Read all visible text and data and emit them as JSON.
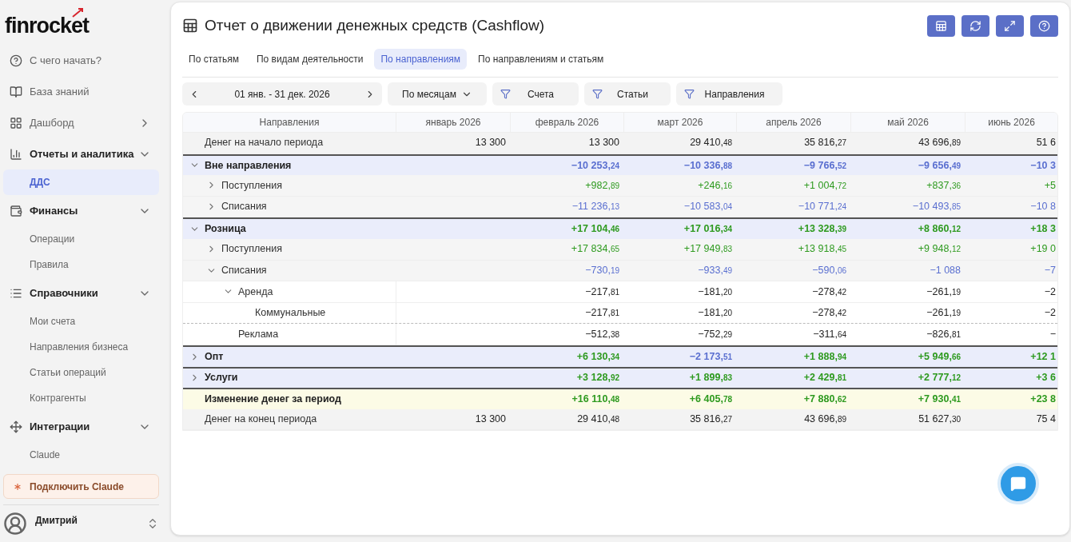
{
  "sidebar": {
    "logo": "finrocket",
    "nav": [
      {
        "kind": "link",
        "label": "С чего начать?"
      },
      {
        "kind": "link",
        "label": "База знаний"
      },
      {
        "kind": "section",
        "label": "Дашборд",
        "expanded": false
      },
      {
        "kind": "section",
        "label": "Отчеты и аналитика",
        "expanded": true,
        "children": [
          {
            "label": "ДДС",
            "selected": true
          }
        ]
      },
      {
        "kind": "section",
        "label": "Финансы",
        "expanded": true,
        "children": [
          {
            "label": "Операции",
            "selected": false
          },
          {
            "label": "Правила",
            "selected": false
          }
        ]
      },
      {
        "kind": "section",
        "label": "Справочники",
        "expanded": true,
        "children": [
          {
            "label": "Мои счета",
            "selected": false
          },
          {
            "label": "Направления бизнеса",
            "selected": false
          },
          {
            "label": "Статьи операций",
            "selected": false
          },
          {
            "label": "Контрагенты",
            "selected": false
          }
        ]
      },
      {
        "kind": "section",
        "label": "Интеграции",
        "expanded": true,
        "children": [
          {
            "label": "Claude",
            "selected": false
          }
        ]
      }
    ],
    "connect_button": "Подключить Claude",
    "user": {
      "name": "Дмитрий"
    }
  },
  "header": {
    "title": "Отчет о движении денежных средств (Cashflow)"
  },
  "tabs": [
    {
      "label": "По статьям",
      "selected": false
    },
    {
      "label": "По видам деятельности",
      "selected": false
    },
    {
      "label": "По направлениям",
      "selected": true
    },
    {
      "label": "По направлениям и статьям",
      "selected": false
    }
  ],
  "toolbar": {
    "date_range": "01 янв. - 31 дек. 2026",
    "period": "По месяцам",
    "filters": [
      "Счета",
      "Статьи",
      "Направления"
    ]
  },
  "table": {
    "columns": [
      "Направления",
      "январь 2026",
      "февраль 2026",
      "март 2026",
      "апрель 2026",
      "май 2026",
      "июнь 2026"
    ],
    "rows": [
      {
        "kind": "balance",
        "label": "Денег на начало периода",
        "start": {
          "text": "13 300",
          "kind": "plain"
        },
        "values": [
          {
            "text": "13 300",
            "kind": "plain"
          },
          {
            "text": "29 410,48",
            "kind": "plain"
          },
          {
            "text": "35 816,27",
            "kind": "plain"
          },
          {
            "text": "43 696,89",
            "kind": "plain"
          },
          {
            "text": "51 6",
            "kind": "plain"
          }
        ]
      },
      {
        "kind": "group",
        "label": "Вне направления",
        "expanded": true,
        "values": [
          {
            "text": "−10 253,24",
            "kind": "expense"
          },
          {
            "text": "−10 336,88",
            "kind": "expense"
          },
          {
            "text": "−9 766,52",
            "kind": "expense"
          },
          {
            "text": "−9 656,49",
            "kind": "expense"
          },
          {
            "text": "−10 3",
            "kind": "expense"
          }
        ],
        "children": [
          {
            "kind": "sub",
            "label": "Поступления",
            "expanded": false,
            "values": [
              {
                "text": "+982,89",
                "kind": "income"
              },
              {
                "text": "+246,16",
                "kind": "income"
              },
              {
                "text": "+1 004,72",
                "kind": "income"
              },
              {
                "text": "+837,36",
                "kind": "income"
              },
              {
                "text": "+5",
                "kind": "income"
              }
            ]
          },
          {
            "kind": "sub",
            "label": "Списания",
            "expanded": false,
            "values": [
              {
                "text": "−11 236,13",
                "kind": "expense"
              },
              {
                "text": "−10 583,04",
                "kind": "expense"
              },
              {
                "text": "−10 771,24",
                "kind": "expense"
              },
              {
                "text": "−10 493,85",
                "kind": "expense"
              },
              {
                "text": "−10 8",
                "kind": "expense"
              }
            ]
          }
        ]
      },
      {
        "kind": "group",
        "label": "Розница",
        "expanded": true,
        "values": [
          {
            "text": "+17 104,46",
            "kind": "income"
          },
          {
            "text": "+17 016,34",
            "kind": "income"
          },
          {
            "text": "+13 328,39",
            "kind": "income"
          },
          {
            "text": "+8 860,12",
            "kind": "income"
          },
          {
            "text": "+18 3",
            "kind": "income"
          }
        ],
        "children": [
          {
            "kind": "sub",
            "label": "Поступления",
            "expanded": false,
            "values": [
              {
                "text": "+17 834,65",
                "kind": "income"
              },
              {
                "text": "+17 949,83",
                "kind": "income"
              },
              {
                "text": "+13 918,45",
                "kind": "income"
              },
              {
                "text": "+9 948,12",
                "kind": "income"
              },
              {
                "text": "+19 0",
                "kind": "income"
              }
            ]
          },
          {
            "kind": "sub",
            "label": "Списания",
            "expanded": true,
            "values": [
              {
                "text": "−730,19",
                "kind": "expense"
              },
              {
                "text": "−933,49",
                "kind": "expense"
              },
              {
                "text": "−590,06",
                "kind": "expense"
              },
              {
                "text": "−1 088",
                "kind": "expense"
              },
              {
                "text": "−7",
                "kind": "expense"
              }
            ],
            "children": [
              {
                "kind": "item",
                "label": "Аренда",
                "expanded": true,
                "values": [
                  {
                    "text": "−217,81",
                    "kind": "plain"
                  },
                  {
                    "text": "−181,20",
                    "kind": "plain"
                  },
                  {
                    "text": "−278,42",
                    "kind": "plain"
                  },
                  {
                    "text": "−261,19",
                    "kind": "plain"
                  },
                  {
                    "text": "−2",
                    "kind": "plain"
                  }
                ],
                "children": [
                  {
                    "kind": "detail",
                    "label": "Коммунальные",
                    "values": [
                      {
                        "text": "−217,81",
                        "kind": "plain"
                      },
                      {
                        "text": "−181,20",
                        "kind": "plain"
                      },
                      {
                        "text": "−278,42",
                        "kind": "plain"
                      },
                      {
                        "text": "−261,19",
                        "kind": "plain"
                      },
                      {
                        "text": "−2",
                        "kind": "plain"
                      }
                    ]
                  }
                ]
              },
              {
                "kind": "item",
                "label": "Реклама",
                "values": [
                  {
                    "text": "−512,38",
                    "kind": "plain"
                  },
                  {
                    "text": "−752,29",
                    "kind": "plain"
                  },
                  {
                    "text": "−311,64",
                    "kind": "plain"
                  },
                  {
                    "text": "−826,81",
                    "kind": "plain"
                  },
                  {
                    "text": "−",
                    "kind": "plain"
                  }
                ]
              }
            ]
          }
        ]
      },
      {
        "kind": "group",
        "label": "Опт",
        "expanded": false,
        "values": [
          {
            "text": "+6 130,34",
            "kind": "income"
          },
          {
            "text": "−2 173,51",
            "kind": "expense"
          },
          {
            "text": "+1 888,94",
            "kind": "income"
          },
          {
            "text": "+5 949,66",
            "kind": "income"
          },
          {
            "text": "+12 1",
            "kind": "income"
          }
        ]
      },
      {
        "kind": "group",
        "label": "Услуги",
        "expanded": false,
        "values": [
          {
            "text": "+3 128,92",
            "kind": "income"
          },
          {
            "text": "+1 899,83",
            "kind": "income"
          },
          {
            "text": "+2 429,81",
            "kind": "income"
          },
          {
            "text": "+2 777,12",
            "kind": "income"
          },
          {
            "text": "+3 6",
            "kind": "income"
          }
        ]
      },
      {
        "kind": "total",
        "label": "Изменение денег за период",
        "values": [
          {
            "text": "+16 110,48",
            "kind": "income"
          },
          {
            "text": "+6 405,78",
            "kind": "income"
          },
          {
            "text": "+7 880,62",
            "kind": "income"
          },
          {
            "text": "+7 930,41",
            "kind": "income"
          },
          {
            "text": "+23 8",
            "kind": "income"
          }
        ]
      },
      {
        "kind": "balance",
        "label": "Денег на конец периода",
        "start": {
          "text": "13 300",
          "kind": "plain"
        },
        "values": [
          {
            "text": "29 410,48",
            "kind": "plain"
          },
          {
            "text": "35 816,27",
            "kind": "plain"
          },
          {
            "text": "43 696,89",
            "kind": "plain"
          },
          {
            "text": "51 627,30",
            "kind": "plain"
          },
          {
            "text": "75 4",
            "kind": "plain"
          }
        ]
      }
    ]
  }
}
